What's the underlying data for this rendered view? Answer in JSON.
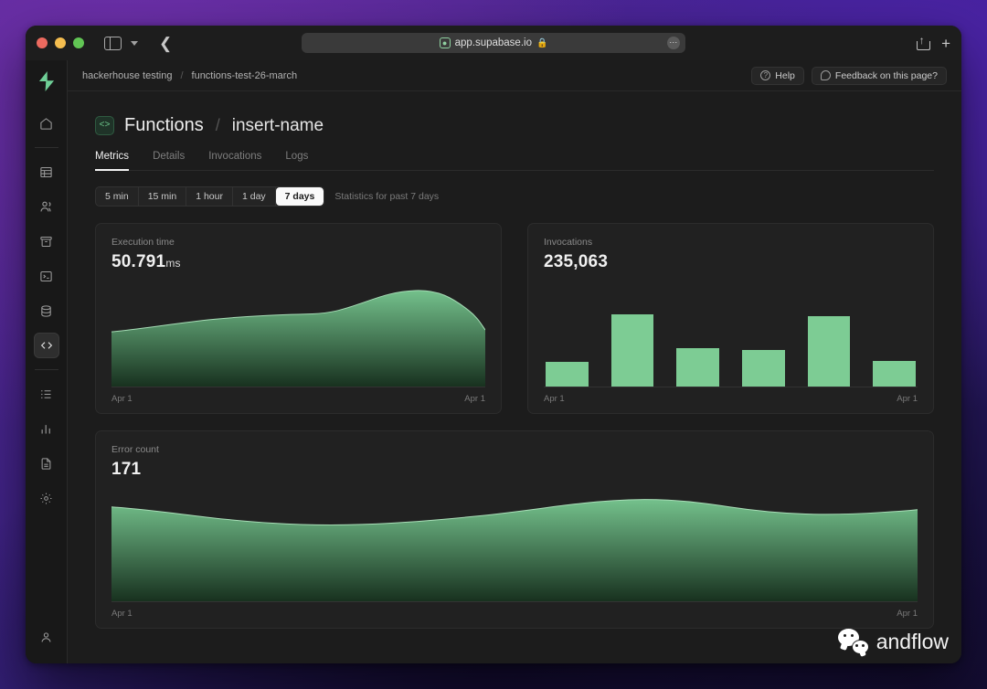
{
  "browser": {
    "url": "app.supabase.io",
    "shield_icon": "extension-shield-icon",
    "lock_icon": "lock-icon",
    "more_icon": "more-options-icon",
    "back_icon": "back-arrow-icon",
    "sidebar_toggle_icon": "sidebar-toggle-icon",
    "tab_dropdown_icon": "chevron-down-icon",
    "share_icon": "share-icon",
    "new_tab_icon": "plus-icon"
  },
  "sidebar": {
    "logo": "supabase-logo",
    "items": [
      {
        "name": "home",
        "icon": "home-icon"
      },
      {
        "name": "table-editor",
        "icon": "table-icon"
      },
      {
        "name": "authentication",
        "icon": "users-icon"
      },
      {
        "name": "storage",
        "icon": "archive-icon"
      },
      {
        "name": "sql-editor",
        "icon": "terminal-icon"
      },
      {
        "name": "database",
        "icon": "database-icon"
      },
      {
        "name": "functions",
        "icon": "code-icon",
        "active": true
      },
      {
        "name": "api",
        "icon": "list-icon"
      },
      {
        "name": "reports",
        "icon": "bar-chart-icon"
      },
      {
        "name": "logs",
        "icon": "document-icon"
      },
      {
        "name": "settings",
        "icon": "gear-icon"
      }
    ],
    "account_icon": "user-account-icon"
  },
  "topbar": {
    "breadcrumb": [
      "hackerhouse testing",
      "functions-test-26-march"
    ],
    "breadcrumb_separator": "/",
    "help_label": "Help",
    "help_icon": "question-circle-icon",
    "feedback_label": "Feedback on this page?",
    "feedback_icon": "chat-bubble-icon"
  },
  "page": {
    "badge_icon": "code-brackets-icon",
    "title": "Functions",
    "separator": "/",
    "subtitle": "insert-name",
    "tabs": [
      {
        "label": "Metrics",
        "active": true
      },
      {
        "label": "Details",
        "active": false
      },
      {
        "label": "Invocations",
        "active": false
      },
      {
        "label": "Logs",
        "active": false
      }
    ]
  },
  "range": {
    "options": [
      {
        "label": "5 min",
        "active": false
      },
      {
        "label": "15 min",
        "active": false
      },
      {
        "label": "1 hour",
        "active": false
      },
      {
        "label": "1 day",
        "active": false
      },
      {
        "label": "7 days",
        "active": true
      }
    ],
    "note": "Statistics for past 7 days"
  },
  "colors": {
    "accent_green": "#7dcc94",
    "area_top": "#6fbd89",
    "area_bottom": "#18311f",
    "card_bg": "#212121",
    "app_bg": "#1c1c1c"
  },
  "watermark": {
    "text": "andflow",
    "icon": "wechat-icon"
  },
  "chart_data": [
    {
      "id": "execution-time",
      "type": "area",
      "title": "Execution time",
      "value": "50.791",
      "unit": "ms",
      "xlabel": "",
      "ylabel": "",
      "x_tick_start": "Apr 1",
      "x_tick_end": "Apr 1",
      "grid": false,
      "legend": "none",
      "x": [
        0,
        1,
        2,
        3,
        4,
        5,
        6,
        7,
        8,
        9,
        10
      ],
      "values": [
        44,
        47,
        50,
        52,
        53,
        54,
        54,
        60,
        69,
        71,
        62,
        44
      ],
      "ylim": [
        0,
        80
      ]
    },
    {
      "id": "invocations",
      "type": "bar",
      "title": "Invocations",
      "value": "235,063",
      "unit": "",
      "xlabel": "",
      "ylabel": "",
      "x_tick_start": "Apr 1",
      "x_tick_end": "Apr 1",
      "grid": false,
      "legend": "none",
      "categories": [
        "1",
        "2",
        "3",
        "4",
        "5",
        "6"
      ],
      "values": [
        26,
        74,
        40,
        38,
        72,
        27
      ],
      "ylim": [
        0,
        100
      ]
    },
    {
      "id": "error-count",
      "type": "area",
      "title": "Error count",
      "value": "171",
      "unit": "",
      "xlabel": "",
      "ylabel": "",
      "x_tick_start": "Apr 1",
      "x_tick_end": "Apr 1",
      "grid": false,
      "legend": "none",
      "x": [
        0,
        1,
        2,
        3,
        4,
        5,
        6,
        7,
        8,
        9,
        10
      ],
      "values": [
        76,
        72,
        69,
        68,
        69,
        73,
        80,
        85,
        86,
        83,
        78,
        76,
        77
      ],
      "ylim": [
        0,
        100
      ]
    }
  ]
}
